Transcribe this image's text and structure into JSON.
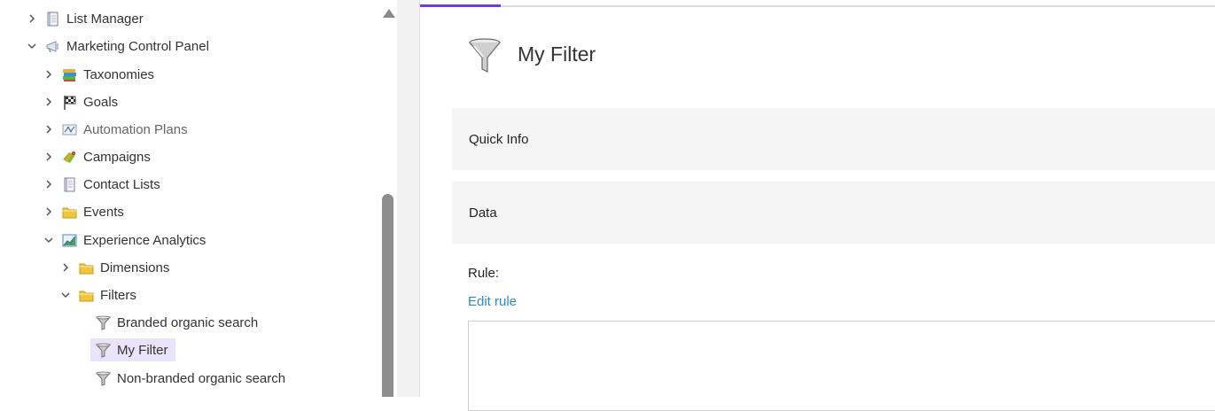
{
  "tree": {
    "items": [
      {
        "label": "List Manager",
        "icon": "list-icon",
        "expanded": false,
        "muted": false
      },
      {
        "label": "Marketing Control Panel",
        "icon": "megaphone-icon",
        "expanded": true,
        "muted": false
      },
      {
        "label": "Taxonomies",
        "icon": "books-icon",
        "expanded": false,
        "muted": false
      },
      {
        "label": "Goals",
        "icon": "checkered-flag-icon",
        "expanded": false,
        "muted": false
      },
      {
        "label": "Automation Plans",
        "icon": "automation-plan-icon",
        "expanded": false,
        "muted": true
      },
      {
        "label": "Campaigns",
        "icon": "campaign-icon",
        "expanded": false,
        "muted": false
      },
      {
        "label": "Contact Lists",
        "icon": "list-icon",
        "expanded": false,
        "muted": false
      },
      {
        "label": "Events",
        "icon": "folder-icon",
        "expanded": false,
        "muted": false
      },
      {
        "label": "Experience Analytics",
        "icon": "chart-icon",
        "expanded": true,
        "muted": false
      },
      {
        "label": "Dimensions",
        "icon": "folder-icon",
        "expanded": false,
        "muted": false
      },
      {
        "label": "Filters",
        "icon": "folder-icon",
        "expanded": true,
        "muted": false
      },
      {
        "label": "Branded organic search",
        "icon": "funnel-icon",
        "expanded": null,
        "muted": false
      },
      {
        "label": "My Filter",
        "icon": "funnel-icon",
        "expanded": null,
        "muted": false,
        "selected": true
      },
      {
        "label": "Non-branded organic search",
        "icon": "funnel-icon",
        "expanded": null,
        "muted": false
      }
    ]
  },
  "content": {
    "title": "My Filter",
    "title_icon": "funnel-icon",
    "sections": [
      {
        "label": "Quick Info"
      },
      {
        "label": "Data"
      }
    ],
    "rule_label": "Rule:",
    "edit_rule_link": "Edit rule"
  },
  "colors": {
    "accent": "#6e3fd8",
    "link": "#2d8ac7",
    "selected_row": "#e9e4fa",
    "section_bg": "#f5f5f5"
  }
}
